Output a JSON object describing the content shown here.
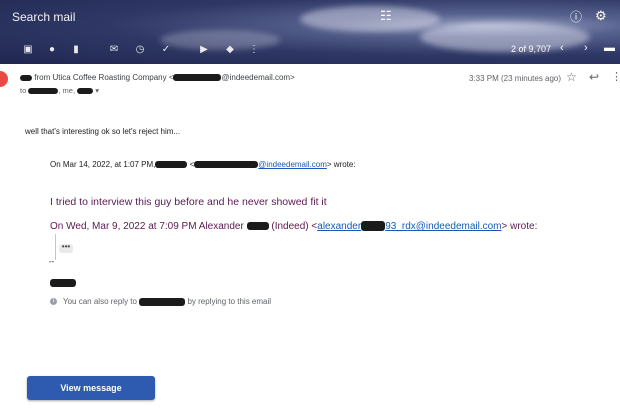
{
  "header": {
    "search_placeholder": "Search mail",
    "tune_icon": "tune-icon",
    "help_icon": "help-icon",
    "settings_icon": "gear-icon"
  },
  "toolbar": {
    "icons": [
      "archive-icon",
      "report-spam-icon",
      "delete-icon",
      "mark-unread-icon",
      "snooze-icon",
      "add-task-icon",
      "move-to-icon",
      "label-icon",
      "more-icon"
    ],
    "counter": "2 of 9,707"
  },
  "message": {
    "from_prefix": "from Utica Coffee Roasting Company <",
    "from_email_suffix": "@indeedemail.com>",
    "to_prefix": "to",
    "to_me": ", me,",
    "time": "3:33 PM (23 minutes ago)",
    "body_line": "well that's interesting ok so let's reject him...",
    "quote1_prefix": "On Mar 14, 2022, at 1:07 PM,",
    "quote1_email_suffix": "@indeedemail.com",
    "quote1_suffix": "> wrote:",
    "quote2": "I tried to interview this guy before and he never showed fit it",
    "quote3_prefix": "On Wed, Mar 9, 2022 at 7:09 PM Alexander",
    "quote3_mid": "(Indeed) <",
    "quote3_email_a": "alexander",
    "quote3_email_b": "93_rdx@indeedemail.com",
    "quote3_suffix": "> wrote:",
    "ellipsis": "•••",
    "sig_dash": "--",
    "info_prefix": "You can also reply to",
    "info_suffix": "by replying to this email",
    "view_button": "View message"
  }
}
